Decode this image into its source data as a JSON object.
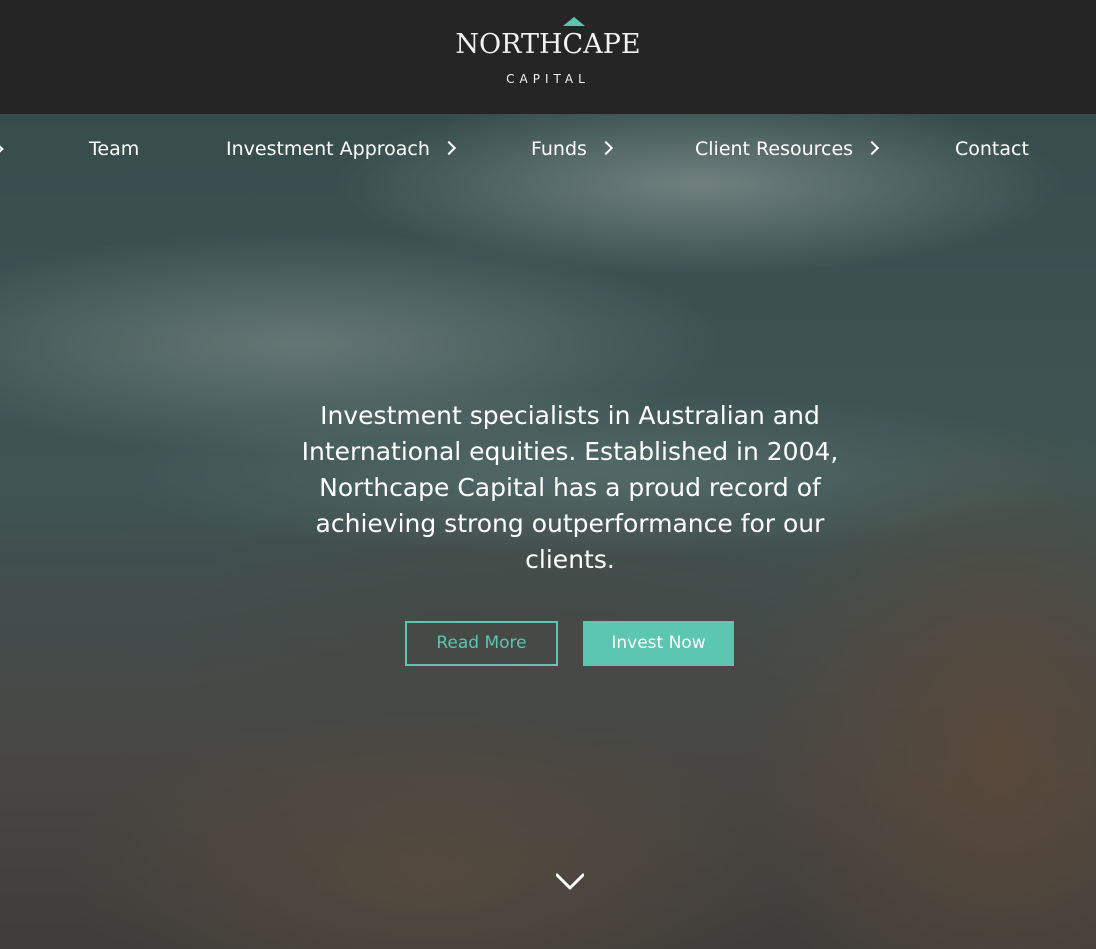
{
  "header": {
    "brand_name": "NORTHCAPE",
    "brand_sub": "CAPITAL",
    "accent": "#5cc6b1"
  },
  "nav": {
    "items": [
      {
        "label": "Team",
        "has_submenu": false
      },
      {
        "label": "Investment Approach",
        "has_submenu": true
      },
      {
        "label": "Funds",
        "has_submenu": true
      },
      {
        "label": "Client Resources",
        "has_submenu": true
      },
      {
        "label": "Contact",
        "has_submenu": false
      }
    ]
  },
  "hero": {
    "tagline": "Investment specialists in Australian and International equities. Established in 2004, Northcape Capital has a proud record of achieving strong outperformance for our clients.",
    "read_more_label": "Read More",
    "invest_now_label": "Invest Now",
    "scroll_icon": "chevron-down-icon"
  },
  "colors": {
    "header_bg": "#252525",
    "accent": "#5cc6b1",
    "text": "#ffffff"
  }
}
